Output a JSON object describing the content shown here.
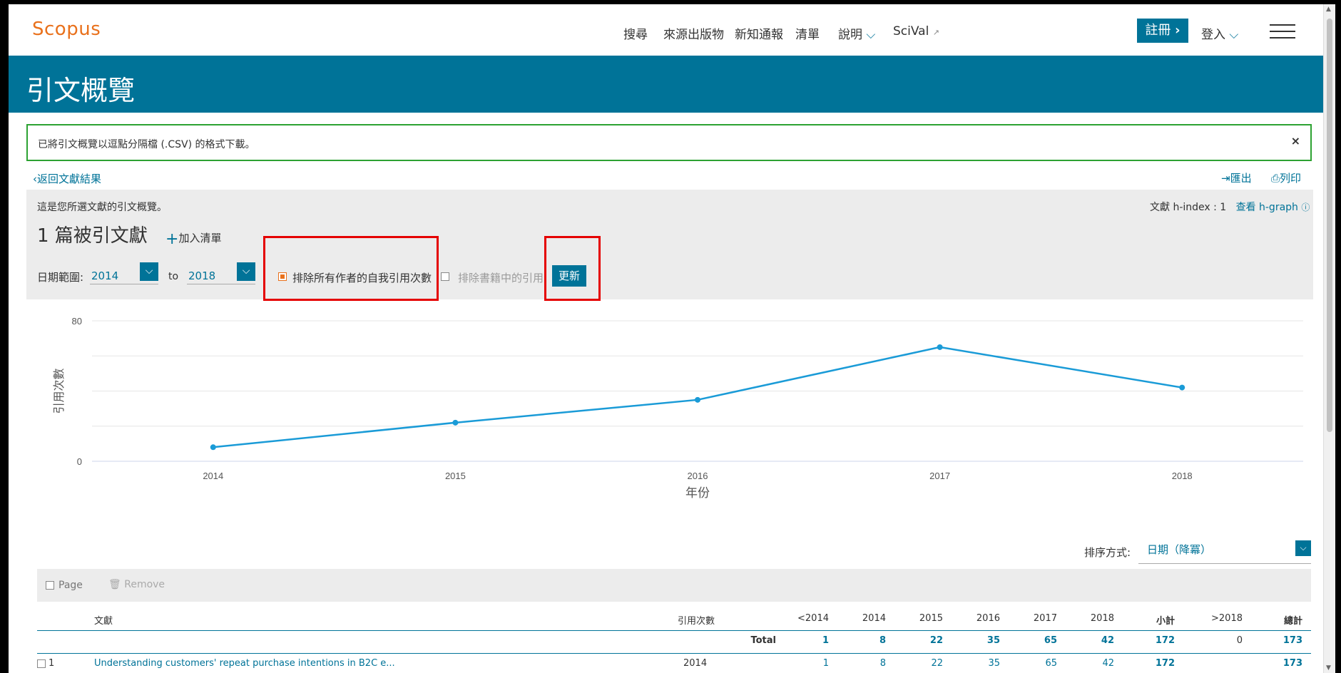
{
  "nav": {
    "logo": "Scopus",
    "items": [
      "搜尋",
      "來源出版物",
      "新知通報",
      "清單",
      "說明",
      "SciVal"
    ],
    "signup": "註冊",
    "login": "登入"
  },
  "banner": {
    "title": "引文概覽"
  },
  "notice": {
    "text": "已將引文概覽以逗點分隔檔 (.CSV) 的格式下載。",
    "close": "×"
  },
  "actions": {
    "back": "返回文獻結果",
    "export": "匯出",
    "print": "列印"
  },
  "summary": {
    "description": "這是您所選文獻的引文概覽。",
    "hindex_label": "文獻 h-index : 1",
    "hgraph": "查看 h-graph",
    "count": "1 篇被引文獻",
    "add_to_list": "加入清單"
  },
  "filters": {
    "date_range_label": "日期範圍:",
    "from": "2014",
    "to_label": "to",
    "to": "2018",
    "exclude_self": "排除所有作者的自我引用次數",
    "exclude_self_checked": true,
    "exclude_books": "排除書籍中的引用",
    "exclude_books_checked": false,
    "update": "更新"
  },
  "chart_data": {
    "type": "line",
    "x": [
      2014,
      2015,
      2016,
      2017,
      2018
    ],
    "series": [
      {
        "values": [
          8,
          22,
          35,
          65,
          42
        ]
      }
    ],
    "xlabel": "年份",
    "ylabel": "引用次數",
    "ylim": [
      0,
      80
    ],
    "yticks": [
      0,
      80
    ],
    "grid": true,
    "color": "#1a9bd7"
  },
  "sort": {
    "label": "排序方式:",
    "value": "日期（降冪）"
  },
  "toolbar": {
    "page": "Page",
    "remove": "Remove"
  },
  "table": {
    "headers": [
      "文獻",
      "引用次數",
      "<2014",
      "2014",
      "2015",
      "2016",
      "2017",
      "2018",
      "小計",
      ">2018",
      "總計"
    ],
    "total_row": {
      "label": "Total",
      "values": [
        "1",
        "8",
        "22",
        "35",
        "65",
        "42",
        "172",
        "0",
        "173"
      ]
    },
    "rows": [
      {
        "index": "1",
        "title": "Understanding customers' repeat purchase intentions in B2C e...",
        "year": "2014",
        "values": [
          "1",
          "8",
          "22",
          "35",
          "65",
          "42",
          "172",
          "",
          "173"
        ]
      }
    ]
  }
}
